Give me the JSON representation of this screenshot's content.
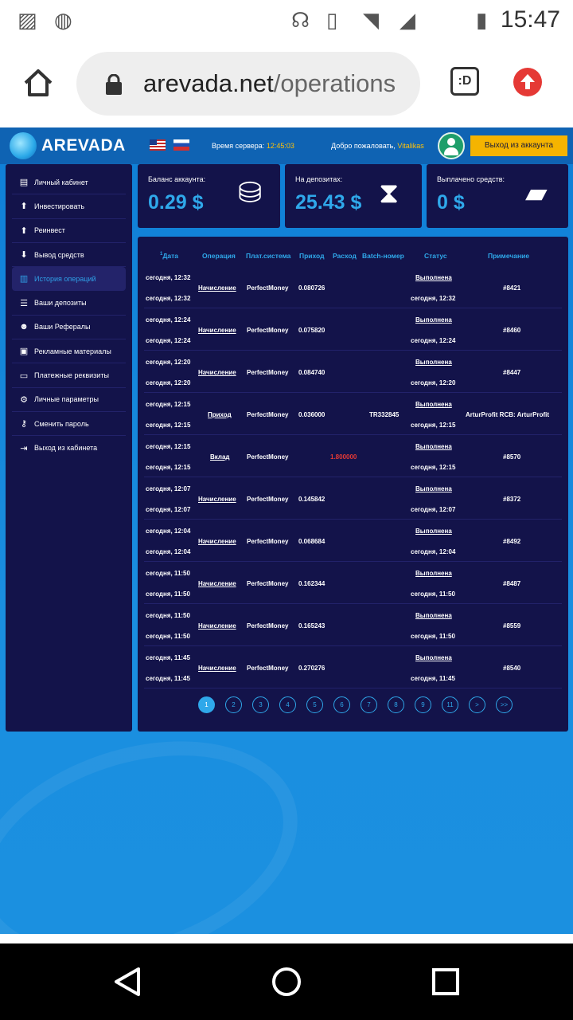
{
  "status_bar": {
    "time": "15:47",
    "icons": [
      "image-icon",
      "vpn-globe-icon",
      "headset-icon",
      "vibrate-icon",
      "wifi-icon",
      "signal-icon",
      "battery-icon"
    ]
  },
  "browser": {
    "url_domain": "arevada.net",
    "url_path": "/operations",
    "tab_label": ":D"
  },
  "site": {
    "logo": "AREVADA",
    "server_time_label": "Время сервера:",
    "server_time_value": "12:45:03",
    "welcome_label": "Добро пожаловать,",
    "username": "Vitalikas",
    "logout_top": "Выход из аккаунта"
  },
  "sidebar": {
    "items": [
      {
        "label": "Личный кабинет",
        "icon": "id-card-icon",
        "glyph": "▤"
      },
      {
        "label": "Инвестировать",
        "icon": "arrow-up-circle-icon",
        "glyph": "⬆"
      },
      {
        "label": "Реинвест",
        "icon": "arrow-up-circle-icon",
        "glyph": "⬆"
      },
      {
        "label": "Вывод средств",
        "icon": "arrow-down-circle-icon",
        "glyph": "⬇"
      },
      {
        "label": "История операций",
        "icon": "bar-chart-icon",
        "glyph": "▥"
      },
      {
        "label": "Ваши депозиты",
        "icon": "list-icon",
        "glyph": "☰"
      },
      {
        "label": "Ваши Рефералы",
        "icon": "users-icon",
        "glyph": "☻"
      },
      {
        "label": "Рекламные материалы",
        "icon": "images-icon",
        "glyph": "▣"
      },
      {
        "label": "Платежные реквизиты",
        "icon": "credit-card-icon",
        "glyph": "▭"
      },
      {
        "label": "Личные параметры",
        "icon": "gears-icon",
        "glyph": "⚙"
      },
      {
        "label": "Сменить пароль",
        "icon": "key-icon",
        "glyph": "⚷"
      },
      {
        "label": "Выход из кабинета",
        "icon": "sign-out-icon",
        "glyph": "⇥"
      }
    ]
  },
  "cards": [
    {
      "label": "Баланс аккаунта:",
      "value": "0.29 $",
      "icon": "coins-icon",
      "glyph": "⛁"
    },
    {
      "label": "На депозитах:",
      "value": "25.43 $",
      "icon": "hourglass-money-icon",
      "glyph": "⧗"
    },
    {
      "label": "Выплачено средств:",
      "value": "0 $",
      "icon": "wallet-icon",
      "glyph": "▰"
    }
  ],
  "table": {
    "headers": {
      "sort_mark": "1",
      "date": "Дата",
      "operation": "Операция",
      "payment_system": "Плат.система",
      "income": "Приход",
      "expense": "Расход",
      "batch": "Batch-номер",
      "status": "Статус",
      "note": "Примечание"
    },
    "rows": [
      {
        "date1": "сегодня, 12:32",
        "date2": "сегодня, 12:32",
        "op": "Начисление",
        "ps": "PerfectMoney",
        "income": "0.080726",
        "expense": "",
        "batch": "",
        "status": "Выполнена",
        "status_date": "сегодня, 12:32",
        "note": "#8421"
      },
      {
        "date1": "сегодня, 12:24",
        "date2": "сегодня, 12:24",
        "op": "Начисление",
        "ps": "PerfectMoney",
        "income": "0.075820",
        "expense": "",
        "batch": "",
        "status": "Выполнена",
        "status_date": "сегодня, 12:24",
        "note": "#8460"
      },
      {
        "date1": "сегодня, 12:20",
        "date2": "сегодня, 12:20",
        "op": "Начисление",
        "ps": "PerfectMoney",
        "income": "0.084740",
        "expense": "",
        "batch": "",
        "status": "Выполнена",
        "status_date": "сегодня, 12:20",
        "note": "#8447"
      },
      {
        "date1": "сегодня, 12:15",
        "date2": "сегодня, 12:15",
        "op": "Приход",
        "ps": "PerfectMoney",
        "income": "0.036000",
        "expense": "",
        "batch": "TR332845",
        "status": "Выполнена",
        "status_date": "сегодня, 12:15",
        "note": "ArturProfit RCB: ArturProfit"
      },
      {
        "date1": "сегодня, 12:15",
        "date2": "сегодня, 12:15",
        "op": "Вклад",
        "ps": "PerfectMoney",
        "income": "",
        "expense": "1.800000",
        "batch": "",
        "status": "Выполнена",
        "status_date": "сегодня, 12:15",
        "note": "#8570"
      },
      {
        "date1": "сегодня, 12:07",
        "date2": "сегодня, 12:07",
        "op": "Начисление",
        "ps": "PerfectMoney",
        "income": "0.145842",
        "expense": "",
        "batch": "",
        "status": "Выполнена",
        "status_date": "сегодня, 12:07",
        "note": "#8372"
      },
      {
        "date1": "сегодня, 12:04",
        "date2": "сегодня, 12:04",
        "op": "Начисление",
        "ps": "PerfectMoney",
        "income": "0.068684",
        "expense": "",
        "batch": "",
        "status": "Выполнена",
        "status_date": "сегодня, 12:04",
        "note": "#8492"
      },
      {
        "date1": "сегодня, 11:50",
        "date2": "сегодня, 11:50",
        "op": "Начисление",
        "ps": "PerfectMoney",
        "income": "0.162344",
        "expense": "",
        "batch": "",
        "status": "Выполнена",
        "status_date": "сегодня, 11:50",
        "note": "#8487"
      },
      {
        "date1": "сегодня, 11:50",
        "date2": "сегодня, 11:50",
        "op": "Начисление",
        "ps": "PerfectMoney",
        "income": "0.165243",
        "expense": "",
        "batch": "",
        "status": "Выполнена",
        "status_date": "сегодня, 11:50",
        "note": "#8559"
      },
      {
        "date1": "сегодня, 11:45",
        "date2": "сегодня, 11:45",
        "op": "Начисление",
        "ps": "PerfectMoney",
        "income": "0.270276",
        "expense": "",
        "batch": "",
        "status": "Выполнена",
        "status_date": "сегодня, 11:45",
        "note": "#8540"
      }
    ]
  },
  "pagination": {
    "pages": [
      "1",
      "2",
      "3",
      "4",
      "5",
      "6",
      "7",
      "8",
      "9",
      "11",
      ">",
      ">>"
    ],
    "active": "1"
  },
  "colors": {
    "accent": "#2fa8ea",
    "panel": "#13134a",
    "logout_button": "#f5b400",
    "expense_red": "#e53935"
  }
}
